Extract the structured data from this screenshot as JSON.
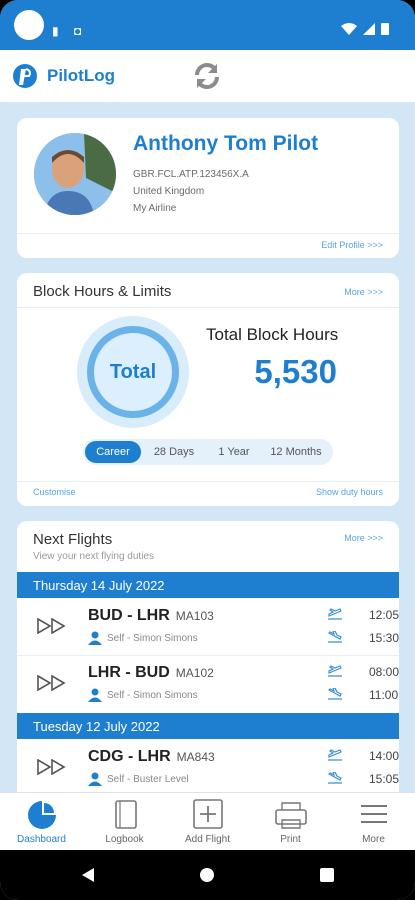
{
  "app": {
    "title": "PilotLog"
  },
  "profile": {
    "name": "Anthony Tom Pilot",
    "license": "GBR.FCL.ATP.123456X.A",
    "country": "United Kingdom",
    "airline": "My Airline",
    "edit_link": "Edit Profile >>>"
  },
  "hours": {
    "title": "Block Hours & Limits",
    "more": "More >>>",
    "ring_label": "Total",
    "total_label": "Total Block Hours",
    "total_value": "5,530",
    "tabs": [
      "Career",
      "28 Days",
      "1 Year",
      "12 Months"
    ],
    "active_tab": "Career",
    "customise": "Customise",
    "duty_link": "Show duty hours"
  },
  "flights": {
    "title": "Next Flights",
    "more": "More >>>",
    "subtitle": "View your next flying duties",
    "groups": [
      {
        "date": "Thursday 14 July 2022",
        "items": [
          {
            "route": "BUD - LHR",
            "flight_no": "MA103",
            "crew": "Self - Simon Simons",
            "dep": "12:05",
            "arr": "15:30"
          },
          {
            "route": "LHR - BUD",
            "flight_no": "MA102",
            "crew": "Self - Simon Simons",
            "dep": "08:00",
            "arr": "11:00"
          }
        ]
      },
      {
        "date": "Tuesday 12 July 2022",
        "items": [
          {
            "route": "CDG - LHR",
            "flight_no": "MA843",
            "crew": "Self - Buster Level",
            "dep": "14:00",
            "arr": "15:05"
          }
        ]
      }
    ]
  },
  "nav": {
    "items": [
      {
        "label": "Dashboard",
        "icon": "pie-chart-icon"
      },
      {
        "label": "Logbook",
        "icon": "book-icon"
      },
      {
        "label": "Add Flight",
        "icon": "plus-box-icon"
      },
      {
        "label": "Print",
        "icon": "printer-icon"
      },
      {
        "label": "More",
        "icon": "menu-icon"
      }
    ],
    "active": "Dashboard"
  },
  "colors": {
    "primary": "#1e7fd0",
    "background": "#d2e6f5"
  }
}
